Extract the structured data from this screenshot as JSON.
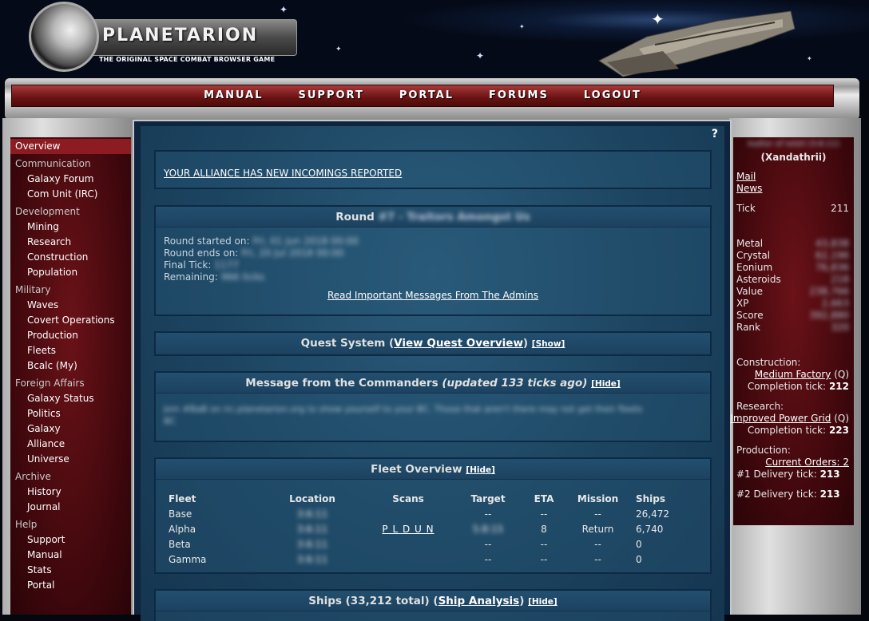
{
  "header": {
    "logo_name": "PLANETARION",
    "logo_tagline": "THE ORIGINAL SPACE COMBAT BROWSER GAME"
  },
  "nav": [
    "MANUAL",
    "SUPPORT",
    "PORTAL",
    "FORUMS",
    "LOGOUT"
  ],
  "sidebar": {
    "overview": "Overview",
    "sections": [
      {
        "title": "Communication",
        "items": [
          "Galaxy Forum",
          "Com Unit (IRC)"
        ]
      },
      {
        "title": "Development",
        "items": [
          "Mining",
          "Research",
          "Construction",
          "Population"
        ]
      },
      {
        "title": "Military",
        "items": [
          "Waves",
          "Covert Operations",
          "Production",
          "Fleets",
          "Bcalc (My)"
        ]
      },
      {
        "title": "Foreign Affairs",
        "items": [
          "Galaxy Status",
          "Politics",
          "Galaxy",
          "Alliance",
          "Universe"
        ]
      },
      {
        "title": "Archive",
        "items": [
          "History",
          "Journal"
        ]
      },
      {
        "title": "Help",
        "items": [
          "Support",
          "Manual",
          "Stats",
          "Portal"
        ]
      }
    ]
  },
  "main": {
    "help": "?",
    "alert": "YOUR ALLIANCE HAS NEW INCOMINGS REPORTED",
    "round": {
      "title_prefix": "Round",
      "title_blurred": "#7 - Traitors Amongst Us",
      "started_label": "Round started on:",
      "started_value": "Fri, 01 Jun 2018 00:00",
      "ends_label": "Round ends on:",
      "ends_value": "Fri, 20 Jul 2018 00:00",
      "final_label": "Final Tick:",
      "final_value": "1177",
      "remaining_label": "Remaining:",
      "remaining_value": "966 ticks",
      "admins_link": "Read Important Messages From The Admins"
    },
    "quest": {
      "title": "Quest System (",
      "link": "View Quest Overview",
      "close": ")",
      "toggle": "[Show]"
    },
    "commanders": {
      "title": "Message from the Commanders",
      "updated": "(updated 133 ticks ago)",
      "toggle": "[Hide]",
      "message_blurred": "Join #BaB on irc.planetarion.org to show yourself to your BC. Those that aren't there may not get their fleets sorted out and it won't help us get it sorted.",
      "message_blurred_2": "BC"
    },
    "fleet_overview": {
      "title": "Fleet Overview",
      "toggle": "[Hide]",
      "columns": [
        "Fleet",
        "Location",
        "Scans",
        "Target",
        "ETA",
        "Mission",
        "Ships"
      ],
      "rows": [
        {
          "fleet": "Base",
          "location": "3:6:11",
          "scans": "",
          "target": "--",
          "eta": "--",
          "mission": "--",
          "ships": "26,472"
        },
        {
          "fleet": "Alpha",
          "location": "3:6:11",
          "scans": "P L D U N",
          "target": "5:8:15",
          "eta": "8",
          "mission": "Return",
          "ships": "6,740"
        },
        {
          "fleet": "Beta",
          "location": "3:6:11",
          "scans": "",
          "target": "--",
          "eta": "--",
          "mission": "--",
          "ships": "0"
        },
        {
          "fleet": "Gamma",
          "location": "3:6:11",
          "scans": "",
          "target": "--",
          "eta": "--",
          "mission": "--",
          "ships": "0"
        }
      ]
    },
    "ships": {
      "title": "Ships (33,212 total) (",
      "link": "Ship Analysis",
      "close": ")",
      "toggle": "[Hide]"
    }
  },
  "rightbar": {
    "planet_blurred": "Ixaltor of Ixlotl (3:6:11)",
    "ruler": "(Xandathrii)",
    "mail": "Mail",
    "news": "News",
    "tick_label": "Tick",
    "tick_value": "211",
    "stats": [
      {
        "label": "Metal",
        "value": "43,838"
      },
      {
        "label": "Crystal",
        "value": "62,196"
      },
      {
        "label": "Eonium",
        "value": "76,836"
      },
      {
        "label": "Asteroids",
        "value": "218"
      },
      {
        "label": "Value",
        "value": "238,766"
      },
      {
        "label": "XP",
        "value": "2,663"
      },
      {
        "label": "Score",
        "value": "392,880"
      },
      {
        "label": "Rank",
        "value": "320"
      }
    ],
    "construction": {
      "label": "Construction:",
      "item": "Medium Factory",
      "q": "(Q)",
      "completion_label": "Completion tick:",
      "completion_value": "212"
    },
    "research": {
      "label": "Research:",
      "item": "Improved Power Grid",
      "q": "(Q)",
      "completion_label": "Completion tick:",
      "completion_value": "223"
    },
    "production": {
      "label": "Production:",
      "link": "Current Orders: 2",
      "d1_label": "#1 Delivery tick:",
      "d1_value": "213",
      "d2_label": "#2 Delivery tick:",
      "d2_value": "213"
    }
  }
}
